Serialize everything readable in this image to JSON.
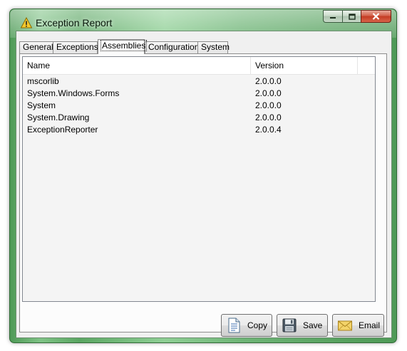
{
  "window": {
    "title": "Exception Report"
  },
  "tabs": [
    {
      "label": "General"
    },
    {
      "label": "Exceptions"
    },
    {
      "label": "Assemblies"
    },
    {
      "label": "Configuration"
    },
    {
      "label": "System"
    }
  ],
  "active_tab": "Assemblies",
  "list": {
    "columns": [
      "Name",
      "Version"
    ],
    "rows": [
      {
        "name": "mscorlib",
        "version": "2.0.0.0"
      },
      {
        "name": "System.Windows.Forms",
        "version": "2.0.0.0"
      },
      {
        "name": "System",
        "version": "2.0.0.0"
      },
      {
        "name": "System.Drawing",
        "version": "2.0.0.0"
      },
      {
        "name": "ExceptionReporter",
        "version": "2.0.0.4"
      }
    ]
  },
  "buttons": {
    "copy": "Copy",
    "save": "Save",
    "email": "Email"
  },
  "icons": {
    "title": "warning-icon",
    "copy": "document-icon",
    "save": "floppy-disk-icon",
    "email": "envelope-icon"
  },
  "colors": {
    "frame": "#6fb577",
    "close_button": "#c43b22",
    "client": "#f0f0f0"
  }
}
